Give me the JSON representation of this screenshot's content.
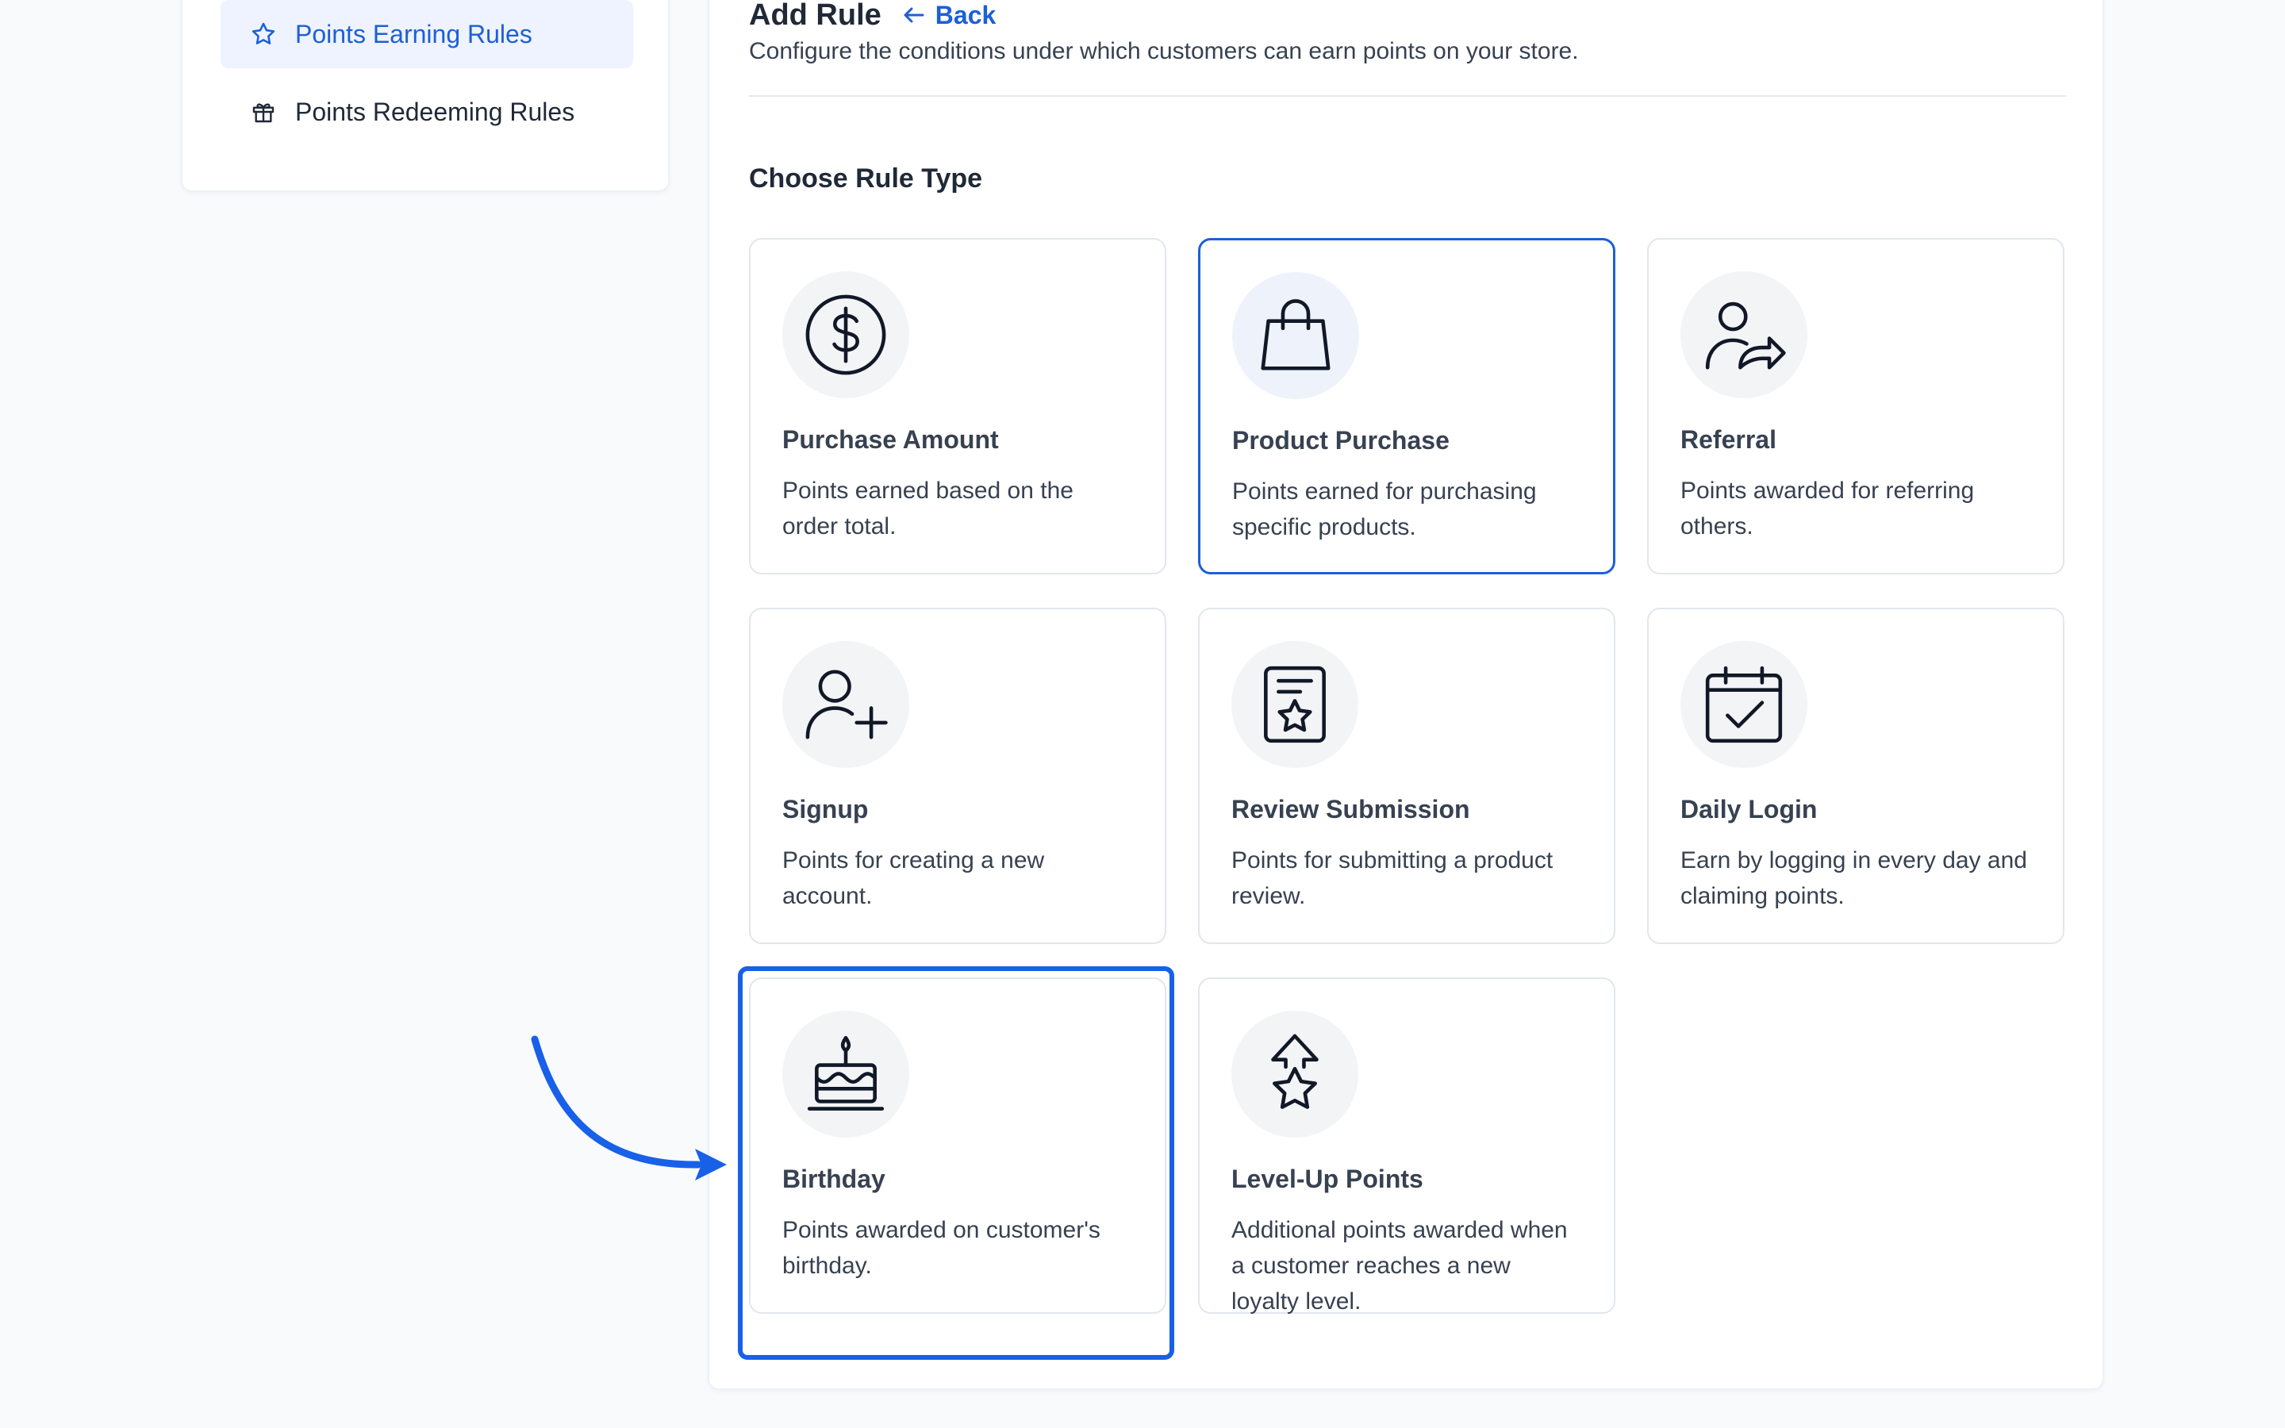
{
  "sidebar": {
    "items": [
      {
        "label": "Points Earning Rules",
        "icon": "star-icon",
        "active": true
      },
      {
        "label": "Points Redeeming Rules",
        "icon": "gift-icon",
        "active": false
      }
    ]
  },
  "header": {
    "title": "Add Rule",
    "back_label": "Back",
    "subtitle": "Configure the conditions under which customers can earn points on your store."
  },
  "section": {
    "title": "Choose Rule Type"
  },
  "cards": [
    {
      "title": "Purchase Amount",
      "desc": "Points earned based on the order total.",
      "icon": "dollar-circle-icon"
    },
    {
      "title": "Product Purchase",
      "desc": "Points earned for purchasing specific products.",
      "icon": "shopping-bag-icon"
    },
    {
      "title": "Referral",
      "desc": "Points awarded for referring others.",
      "icon": "user-share-icon"
    },
    {
      "title": "Signup",
      "desc": "Points for creating a new account.",
      "icon": "user-plus-icon"
    },
    {
      "title": "Review Submission",
      "desc": "Points for submitting a product review.",
      "icon": "review-star-icon"
    },
    {
      "title": "Daily Login",
      "desc": "Earn by logging in every day and claiming points.",
      "icon": "calendar-check-icon"
    },
    {
      "title": "Birthday",
      "desc": "Points awarded on customer's birthday.",
      "icon": "birthday-cake-icon"
    },
    {
      "title": "Level-Up Points",
      "desc": "Additional points awarded when a customer reaches a new loyalty level.",
      "icon": "level-up-star-icon"
    }
  ],
  "colors": {
    "accent": "#1d5fd6",
    "annotation": "#1860e8"
  }
}
